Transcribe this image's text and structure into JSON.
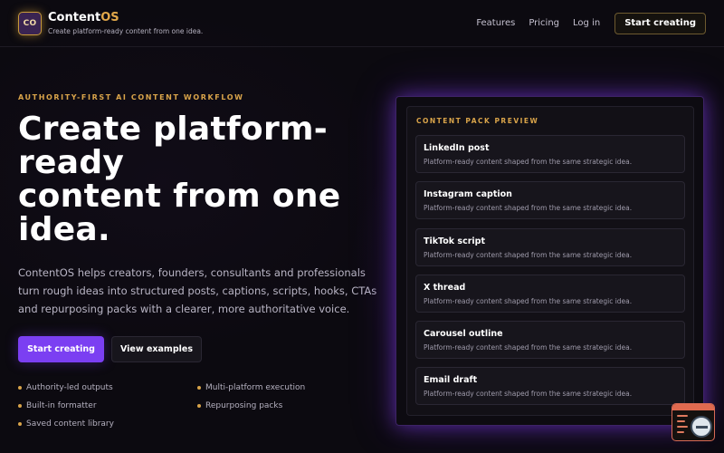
{
  "header": {
    "logo_initials": "CO",
    "brand_name_main": "Content",
    "brand_name_accent": "OS",
    "tagline": "Create platform-ready content from one idea.",
    "nav": [
      {
        "label": "Features"
      },
      {
        "label": "Pricing"
      },
      {
        "label": "Log in"
      }
    ],
    "cta_label": "Start creating"
  },
  "hero": {
    "eyebrow": "AUTHORITY-FIRST AI CONTENT WORKFLOW",
    "title_lines": [
      "Create platform-",
      "ready",
      "content from one",
      "idea."
    ],
    "description": "ContentOS helps creators, founders, consultants and professionals turn rough ideas into structured posts, captions, scripts, hooks, CTAs and repurposing packs with a clearer, more authoritative voice.",
    "primary_button": "Start creating",
    "secondary_button": "View examples",
    "features": [
      {
        "label": "Authority-led outputs"
      },
      {
        "label": "Multi-platform execution"
      },
      {
        "label": "Built-in formatter"
      },
      {
        "label": "Repurposing packs"
      },
      {
        "label": "Saved content library"
      }
    ]
  },
  "preview": {
    "label": "CONTENT PACK PREVIEW",
    "cards": [
      {
        "title": "LinkedIn post",
        "desc": "Platform-ready content shaped from the same strategic idea."
      },
      {
        "title": "Instagram caption",
        "desc": "Platform-ready content shaped from the same strategic idea."
      },
      {
        "title": "TikTok script",
        "desc": "Platform-ready content shaped from the same strategic idea."
      },
      {
        "title": "X thread",
        "desc": "Platform-ready content shaped from the same strategic idea."
      },
      {
        "title": "Carousel outline",
        "desc": "Platform-ready content shaped from the same strategic idea."
      },
      {
        "title": "Email draft",
        "desc": "Platform-ready content shaped from the same strategic idea."
      }
    ]
  },
  "colors": {
    "background": "#0c0a10",
    "accent_purple": "#7b3ff2",
    "accent_gold": "#d9a44a"
  },
  "icons": {
    "logo": "co-logo-icon",
    "bullet": "bullet-dot-icon",
    "corner_widget": "code-search-widget-icon"
  }
}
